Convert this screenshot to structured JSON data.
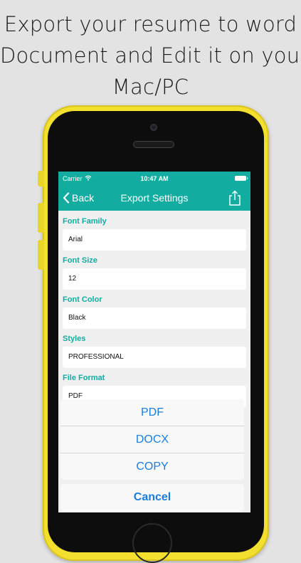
{
  "headline": {
    "line1": "Export your resume to word",
    "line2": "Document and Edit it on your",
    "line3": "Mac/PC"
  },
  "status_bar": {
    "carrier": "Carrier",
    "time": "10:47 AM"
  },
  "nav": {
    "back_label": "Back",
    "title": "Export Settings"
  },
  "fields": [
    {
      "label": "Font Family",
      "value": "Arial"
    },
    {
      "label": "Font Size",
      "value": "12"
    },
    {
      "label": "Font Color",
      "value": "Black"
    },
    {
      "label": "Styles",
      "value": "PROFESSIONAL"
    },
    {
      "label": "File Format",
      "value": "PDF"
    }
  ],
  "action_sheet": {
    "options": [
      "PDF",
      "DOCX",
      "COPY"
    ],
    "cancel": "Cancel"
  },
  "colors": {
    "accent": "#13aca0",
    "action_blue": "#1a7ddb",
    "phone_yellow": "#f2df2e"
  }
}
